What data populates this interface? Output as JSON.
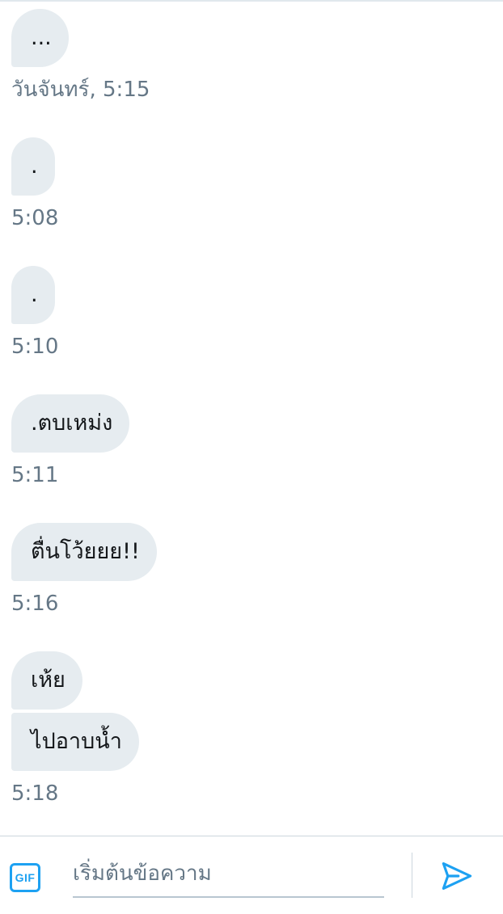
{
  "colors": {
    "accent": "#1da1f2",
    "bubble": "#e6ecf0",
    "muted_text": "#657786",
    "text": "#14171a"
  },
  "messages": [
    {
      "bubbles": [
        "..."
      ],
      "timestamp": "วันจันทร์, 5:15"
    },
    {
      "bubbles": [
        "."
      ],
      "timestamp": "5:08"
    },
    {
      "bubbles": [
        "."
      ],
      "timestamp": "5:10"
    },
    {
      "bubbles": [
        ".ตบเหม่ง"
      ],
      "timestamp": "5:11"
    },
    {
      "bubbles": [
        "ตื่นโว้ยยย!!"
      ],
      "timestamp": "5:16"
    },
    {
      "bubbles": [
        "เห้ย",
        "ไปอาบน้ำ"
      ],
      "timestamp": "5:18"
    }
  ],
  "composer": {
    "gif_label": "GIF",
    "placeholder": "เริ่มต้นข้อความ",
    "value": "",
    "send_icon": "send-icon"
  }
}
